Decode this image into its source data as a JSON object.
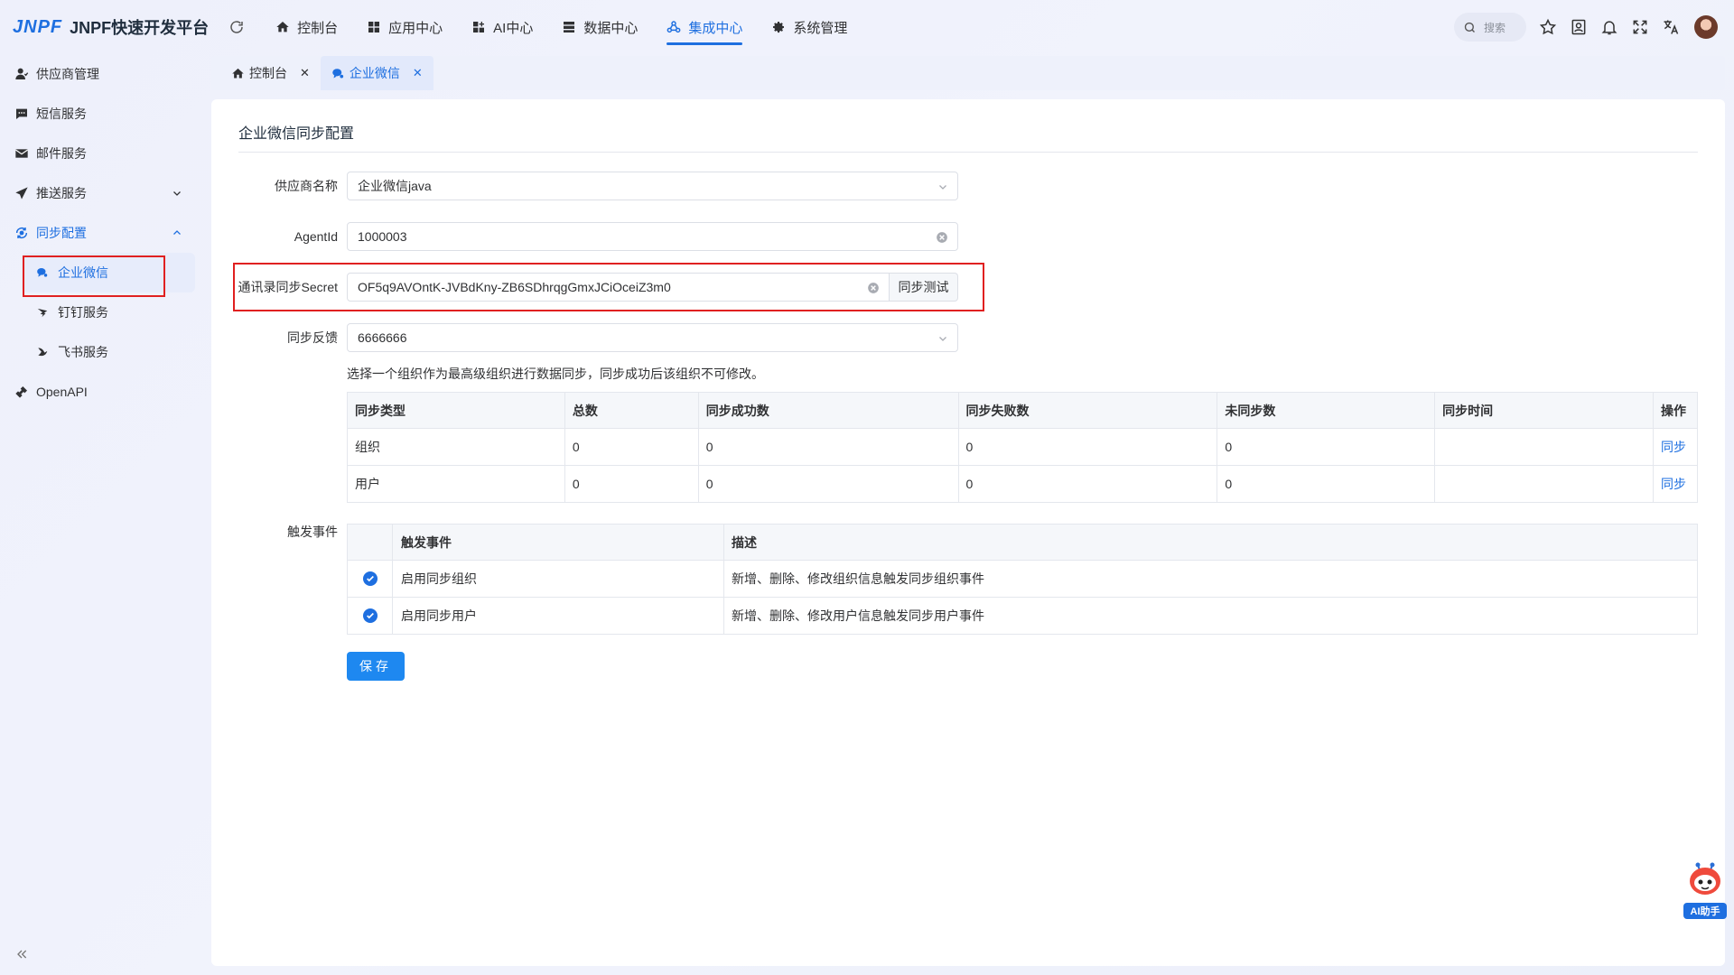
{
  "app": {
    "logo_mark": "JNPF",
    "title": "JNPF快速开发平台"
  },
  "topnav": {
    "items": [
      {
        "label": "控制台",
        "icon": "home-icon"
      },
      {
        "label": "应用中心",
        "icon": "grid-icon"
      },
      {
        "label": "AI中心",
        "icon": "grid-plus-icon"
      },
      {
        "label": "数据中心",
        "icon": "database-icon"
      },
      {
        "label": "集成中心",
        "icon": "integration-icon",
        "active": true
      },
      {
        "label": "系统管理",
        "icon": "gear-icon"
      }
    ],
    "search_placeholder": "搜索"
  },
  "sidebar": {
    "items": [
      {
        "label": "供应商管理",
        "icon": "user-icon"
      },
      {
        "label": "短信服务",
        "icon": "message-icon"
      },
      {
        "label": "邮件服务",
        "icon": "mail-icon"
      },
      {
        "label": "推送服务",
        "icon": "send-icon"
      },
      {
        "label": "同步配置",
        "icon": "sync-icon",
        "expanded": true
      },
      {
        "label": "OpenAPI",
        "icon": "api-icon"
      }
    ],
    "sub_items": [
      {
        "label": "企业微信",
        "icon": "wecom-icon",
        "active": true
      },
      {
        "label": "钉钉服务",
        "icon": "dingtalk-icon"
      },
      {
        "label": "飞书服务",
        "icon": "feishu-icon"
      }
    ]
  },
  "tabs": [
    {
      "label": "控制台",
      "icon": "home-icon"
    },
    {
      "label": "企业微信",
      "icon": "wecom-icon",
      "active": true
    }
  ],
  "page": {
    "title": "企业微信同步配置",
    "form": {
      "supplier_label": "供应商名称",
      "supplier_value": "企业微信java",
      "agentid_label": "AgentId",
      "agentid_value": "1000003",
      "secret_label": "通讯录同步Secret",
      "secret_value": "OF5q9AVOntK-JVBdKny-ZB6SDhrqgGmxJCiOceiZ3m0",
      "secret_button": "同步测试",
      "feedback_label": "同步反馈",
      "feedback_value": "6666666",
      "hint": "选择一个组织作为最高级组织进行数据同步，同步成功后该组织不可修改。"
    },
    "sync_table": {
      "headers": [
        "同步类型",
        "总数",
        "同步成功数",
        "同步失败数",
        "未同步数",
        "同步时间",
        "操作"
      ],
      "rows": [
        [
          "组织",
          "0",
          "0",
          "0",
          "0",
          "",
          "同步"
        ],
        [
          "用户",
          "0",
          "0",
          "0",
          "0",
          "",
          "同步"
        ]
      ]
    },
    "trigger": {
      "label": "触发事件",
      "headers": [
        "",
        "触发事件",
        "描述"
      ],
      "rows": [
        {
          "checked": true,
          "event": "启用同步组织",
          "desc": "新增、删除、修改组织信息触发同步组织事件"
        },
        {
          "checked": true,
          "event": "启用同步用户",
          "desc": "新增、删除、修改用户信息触发同步用户事件"
        }
      ]
    },
    "save_label": "保存"
  },
  "ai_helper": {
    "label": "AI助手"
  },
  "colors": {
    "accent": "#1e6fe0",
    "highlight_box": "#e02020",
    "save_button": "#1e88f0"
  }
}
